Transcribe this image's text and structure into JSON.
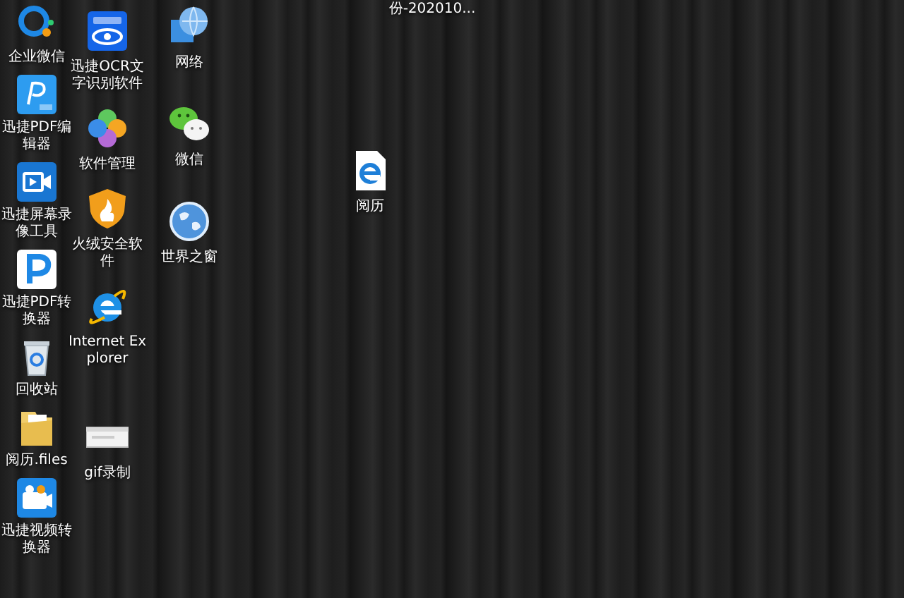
{
  "desktop": {
    "columns": [
      {
        "icons": [
          {
            "kind": "bubble",
            "label": "企业微信"
          },
          {
            "kind": "pdf",
            "label": "迅捷PDF编辑器"
          },
          {
            "kind": "video",
            "label": "迅捷屏幕录像工具"
          },
          {
            "kind": "pconvert",
            "label": "迅捷PDF转换器"
          },
          {
            "kind": "recycle",
            "label": "回收站"
          },
          {
            "kind": "folder",
            "label": "阅历.files"
          },
          {
            "kind": "camera",
            "label": "迅捷视频转换器"
          }
        ]
      },
      {
        "icons": [
          {
            "kind": "ocr",
            "label": "迅捷OCR文字识别软件"
          },
          {
            "kind": "clover",
            "label": "软件管理"
          },
          {
            "kind": "shield",
            "label": "火绒安全软件"
          },
          {
            "kind": "ie",
            "label": "Internet Explorer"
          },
          {
            "kind": "window",
            "label": "gif录制"
          }
        ]
      },
      {
        "icons": [
          {
            "kind": "network",
            "label": "网络"
          },
          {
            "kind": "wechat",
            "label": "微信"
          },
          {
            "kind": "earth",
            "label": "世界之窗"
          }
        ]
      },
      {
        "icons": [
          {
            "kind": "document",
            "label": "阅历"
          }
        ]
      },
      {
        "icons": [
          {
            "kind": "cut",
            "label": "份-202010..."
          }
        ]
      }
    ]
  }
}
